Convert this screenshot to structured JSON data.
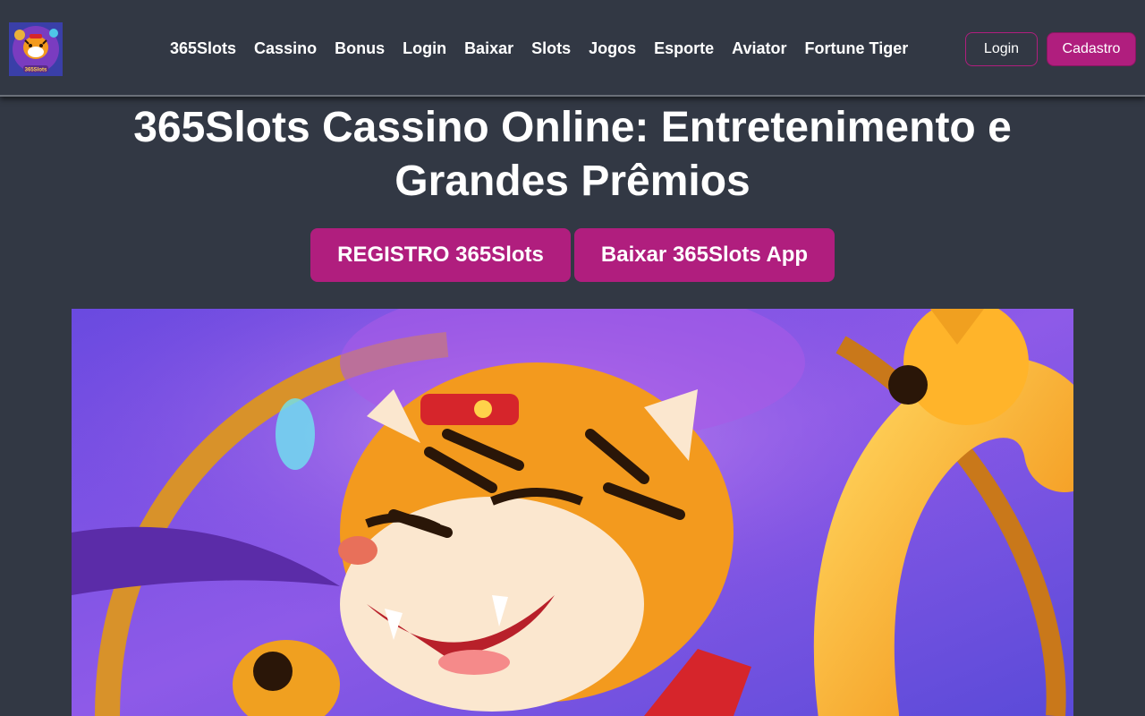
{
  "brand": {
    "logo_text": "365Slots",
    "accent_color": "#b01e7e",
    "background_color": "#323844"
  },
  "nav": {
    "items": [
      {
        "label": "365Slots"
      },
      {
        "label": "Cassino"
      },
      {
        "label": "Bonus"
      },
      {
        "label": "Login"
      },
      {
        "label": "Baixar"
      },
      {
        "label": "Slots"
      },
      {
        "label": "Jogos"
      },
      {
        "label": "Esporte"
      },
      {
        "label": "Aviator"
      },
      {
        "label": "Fortune Tiger"
      }
    ]
  },
  "header_buttons": {
    "login_label": "Login",
    "signup_label": "Cadastro"
  },
  "hero": {
    "title": "365Slots Cassino Online: Entretenimento e Grandes Prêmios",
    "register_label": "REGISTRO 365Slots",
    "download_label": "Baixar 365Slots App"
  },
  "banner": {
    "icon": "tiger-illustration"
  }
}
